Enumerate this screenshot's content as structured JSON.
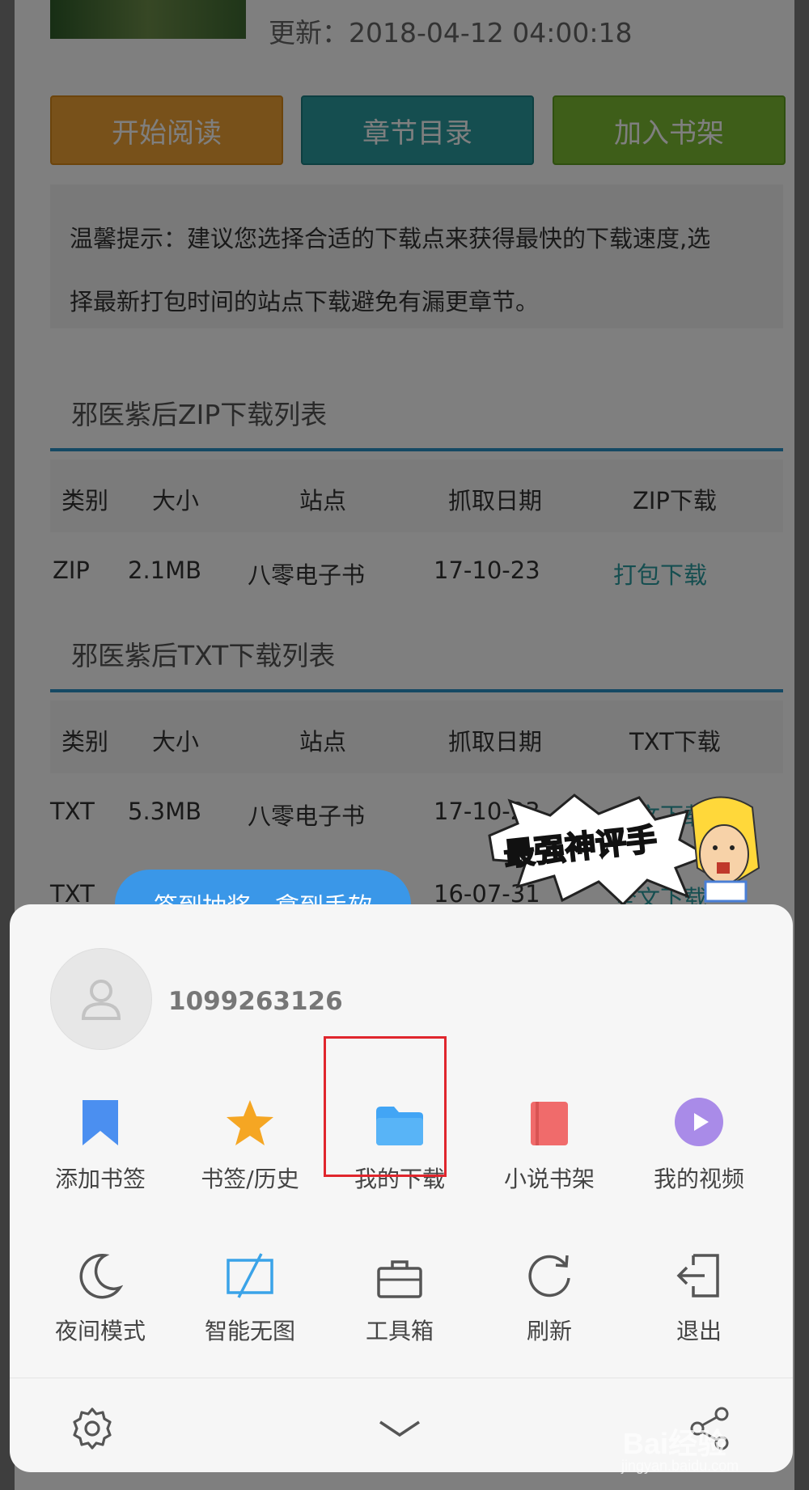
{
  "book": {
    "update_label": "更新：2018-04-12 04:00:18",
    "buttons": {
      "read": "开始阅读",
      "toc": "章节目录",
      "shelf": "加入书架"
    },
    "tip_line1": "温馨提示：建议您选择合适的下载点来获得最快的下载速度,选",
    "tip_line2": "择最新打包时间的站点下载避免有漏更章节。"
  },
  "zip_section": {
    "title": "邪医紫后ZIP下载列表",
    "headers": [
      "类别",
      "大小",
      "站点",
      "抓取日期",
      "ZIP下载"
    ],
    "rows": [
      {
        "type": "ZIP",
        "size": "2.1MB",
        "site": "八零电子书",
        "date": "17-10-23",
        "action": "打包下载"
      }
    ]
  },
  "txt_section": {
    "title": "邪医紫后TXT下载列表",
    "headers": [
      "类别",
      "大小",
      "站点",
      "抓取日期",
      "TXT下载"
    ],
    "rows": [
      {
        "type": "TXT",
        "size": "5.3MB",
        "site": "八零电子书",
        "date": "17-10-23",
        "action": "全文下载"
      },
      {
        "type": "TXT",
        "size": "",
        "site": "",
        "date": "16-07-31",
        "action": "全文下载"
      }
    ]
  },
  "sticker_text": "最强神评手",
  "bubble_text": "签到抽奖，拿到手软",
  "user": {
    "id": "1099263126"
  },
  "menu_row1": [
    {
      "label": "添加书签",
      "icon": "bookmark-icon"
    },
    {
      "label": "书签/历史",
      "icon": "star-icon"
    },
    {
      "label": "我的下载",
      "icon": "folder-icon"
    },
    {
      "label": "小说书架",
      "icon": "book-icon"
    },
    {
      "label": "我的视频",
      "icon": "play-icon"
    }
  ],
  "menu_row2": [
    {
      "label": "夜间模式",
      "icon": "moon-icon"
    },
    {
      "label": "智能无图",
      "icon": "no-image-icon"
    },
    {
      "label": "工具箱",
      "icon": "toolbox-icon"
    },
    {
      "label": "刷新",
      "icon": "refresh-icon"
    },
    {
      "label": "退出",
      "icon": "exit-icon"
    }
  ],
  "watermark": {
    "brand": "Bai经验",
    "url": "jingyan.baidu.com"
  },
  "colors": {
    "accent_blue": "#3a97e8",
    "highlight_red": "#e0262d",
    "bookmark_blue": "#4b8ff0",
    "star_orange": "#f5a623",
    "folder_blue": "#42a5f5",
    "book_red": "#f06b6b",
    "video_purple": "#a98be8"
  }
}
